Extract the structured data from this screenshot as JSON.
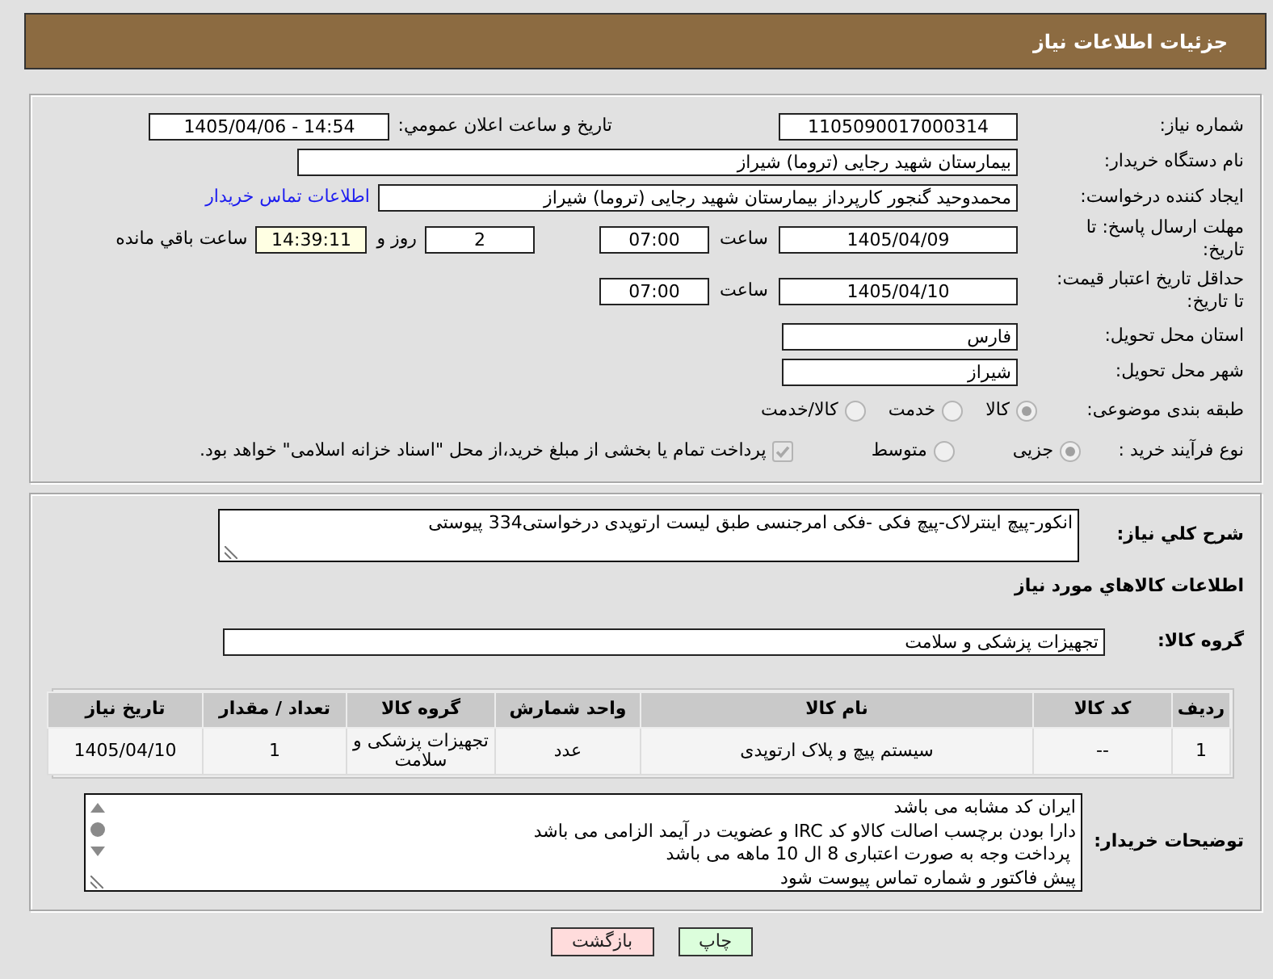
{
  "header": {
    "title": "جزئیات اطلاعات نیاز"
  },
  "summary": {
    "need_number": {
      "label": "شماره نیاز:",
      "value": "1105090017000314"
    },
    "announcement": {
      "label": "تاریخ و ساعت اعلان عمومي:",
      "value": "1405/04/06 - 14:54"
    },
    "buyer_org": {
      "label": "نام دستگاه خریدار:",
      "value": "بیمارستان شهید رجایی (تروما) شیراز"
    },
    "requester": {
      "label": "ایجاد کننده درخواست:",
      "value": "محمدوحید گنجور کارپرداز بیمارستان شهید رجایی (تروما) شیراز",
      "contact_link": "اطلاعات تماس خریدار"
    },
    "reply_deadline": {
      "label": "مهلت ارسال پاسخ: تا تاریخ:",
      "date": "1405/04/09",
      "time_label": "ساعت",
      "time": "07:00",
      "days": "2",
      "days_label": "روز و",
      "remaining": "14:39:11",
      "remaining_label": "ساعت باقي مانده"
    },
    "price_validity": {
      "label": "حداقل تاریخ اعتبار قیمت: تا تاریخ:",
      "date": "1405/04/10",
      "time_label": "ساعت",
      "time": "07:00"
    },
    "province": {
      "label": "استان محل تحویل:",
      "value": "فارس"
    },
    "city": {
      "label": "شهر محل تحویل:",
      "value": "شیراز"
    },
    "category": {
      "label": "طبقه بندی موضوعی:",
      "disabled": true,
      "options": [
        {
          "label": "کالا",
          "selected": true
        },
        {
          "label": "خدمت",
          "selected": false
        },
        {
          "label": "کالا/خدمت",
          "selected": false
        }
      ]
    },
    "purchase_type": {
      "label": "نوع فرآیند خرید :",
      "disabled": true,
      "options": [
        {
          "label": "جزیی",
          "selected": true
        },
        {
          "label": "متوسط",
          "selected": false
        }
      ],
      "treasury_payment": {
        "label": "پرداخت تمام یا بخشی از مبلغ خرید،از محل \"اسناد خزانه اسلامی\" خواهد بود.",
        "checked": true,
        "disabled": true
      }
    }
  },
  "need": {
    "description_label": "شرح کلي نیاز:",
    "description": "انکور-پیچ اینترلاک-پیچ فکی -فکی امرجنسی طبق لیست ارتوپدی درخواستی334 پیوستی",
    "goods_heading": "اطلاعات کالاهاي مورد نیاز",
    "goods_group_label": "گروه کالا:",
    "goods_group": "تجهیزات پزشکی و سلامت",
    "table": {
      "columns": [
        "ردیف",
        "کد کالا",
        "نام کالا",
        "واحد شمارش",
        "گروه کالا",
        "تعداد / مقدار",
        "تاریخ نیاز"
      ],
      "rows": [
        [
          "1",
          "--",
          "سیستم پیچ و پلاک ارتوپدی",
          "عدد",
          "تجهیزات پزشکی و سلامت",
          "1",
          "1405/04/10"
        ]
      ]
    },
    "buyer_notes_label": "توضیحات خریدار:",
    "buyer_notes": [
      "ایران کد مشابه می باشد",
      "دارا بودن برچسب اصالت کالاو کد IRC و عضویت در آیمد الزامی می باشد",
      " پرداخت وجه به صورت اعتباری 8 ال 10 ماهه می باشد",
      "پیش فاکتور و شماره تماس پیوست شود"
    ]
  },
  "buttons": [
    {
      "label": "چاپ",
      "kind": "print"
    },
    {
      "label": "بازگشت",
      "kind": "back"
    }
  ]
}
